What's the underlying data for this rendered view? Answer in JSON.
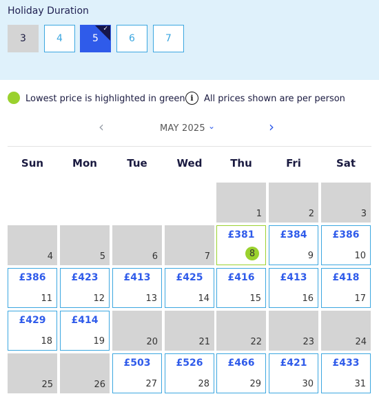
{
  "duration": {
    "title": "Holiday Duration",
    "options": [
      {
        "label": "3",
        "state": "disabled"
      },
      {
        "label": "4",
        "state": "normal"
      },
      {
        "label": "5",
        "state": "selected"
      },
      {
        "label": "6",
        "state": "normal"
      },
      {
        "label": "7",
        "state": "normal"
      }
    ],
    "selected_check": "✓"
  },
  "legend": {
    "lowest_text": "Lowest price is highlighted in green",
    "info_icon": "i",
    "info_text": "All prices shown are per person"
  },
  "month_nav": {
    "prev_icon": "‹",
    "label": "MAY 2025",
    "dropdown_icon": "⌄",
    "next_icon": "›"
  },
  "weekdays": [
    "Sun",
    "Mon",
    "Tue",
    "Wed",
    "Thu",
    "Fri",
    "Sat"
  ],
  "days": [
    {
      "day": "1",
      "price": null
    },
    {
      "day": "2",
      "price": null
    },
    {
      "day": "3",
      "price": null
    },
    {
      "day": "4",
      "price": null
    },
    {
      "day": "5",
      "price": null
    },
    {
      "day": "6",
      "price": null
    },
    {
      "day": "7",
      "price": null
    },
    {
      "day": "8",
      "price": "£381",
      "lowest": true
    },
    {
      "day": "9",
      "price": "£384"
    },
    {
      "day": "10",
      "price": "£386"
    },
    {
      "day": "11",
      "price": "£386"
    },
    {
      "day": "12",
      "price": "£423"
    },
    {
      "day": "13",
      "price": "£413"
    },
    {
      "day": "14",
      "price": "£425"
    },
    {
      "day": "15",
      "price": "£416"
    },
    {
      "day": "16",
      "price": "£413"
    },
    {
      "day": "17",
      "price": "£418"
    },
    {
      "day": "18",
      "price": "£429"
    },
    {
      "day": "19",
      "price": "£414"
    },
    {
      "day": "20",
      "price": null
    },
    {
      "day": "21",
      "price": null
    },
    {
      "day": "22",
      "price": null
    },
    {
      "day": "23",
      "price": null
    },
    {
      "day": "24",
      "price": null
    },
    {
      "day": "25",
      "price": null
    },
    {
      "day": "26",
      "price": null
    },
    {
      "day": "27",
      "price": "£503"
    },
    {
      "day": "28",
      "price": "£526"
    },
    {
      "day": "29",
      "price": "£466"
    },
    {
      "day": "30",
      "price": "£421"
    },
    {
      "day": "31",
      "price": "£433"
    }
  ],
  "colors": {
    "accent_blue": "#2f5bea",
    "border_blue": "#3aa6e0",
    "lowest_green": "#9ad12e",
    "unavailable_grey": "#d4d4d4",
    "panel_bg": "#dff1fb"
  }
}
